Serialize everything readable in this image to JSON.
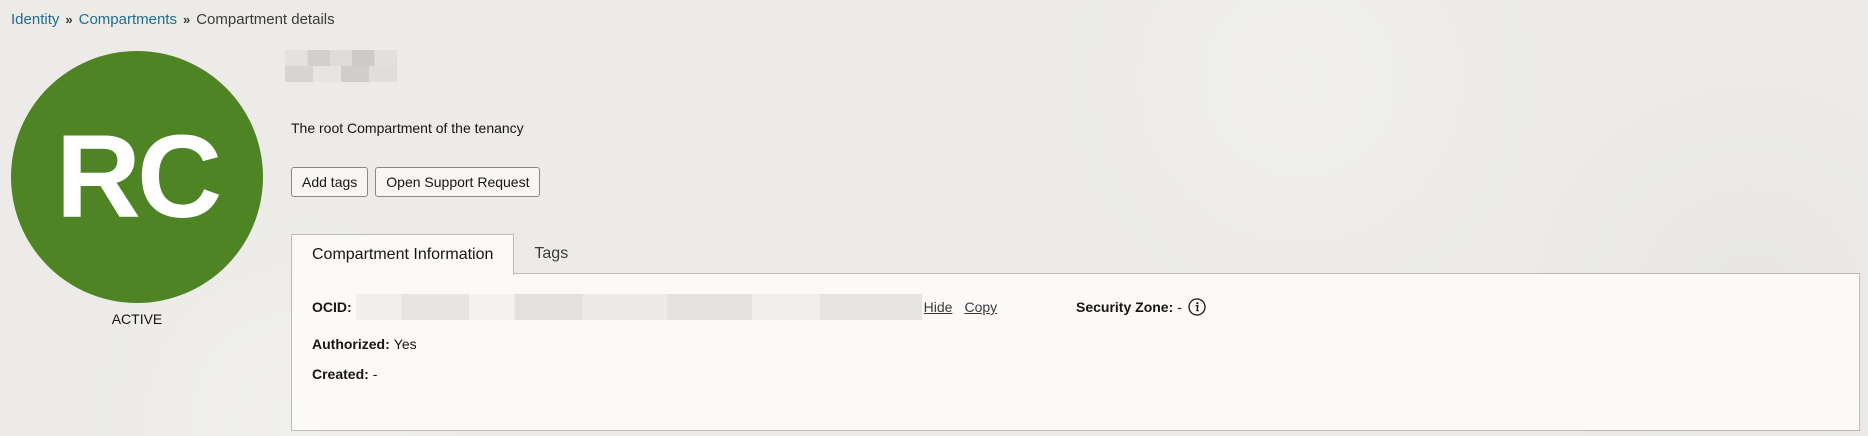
{
  "breadcrumb": {
    "items": [
      "Identity",
      "Compartments"
    ],
    "current": "Compartment details",
    "separator": "»"
  },
  "avatar": {
    "initials": "RC",
    "color": "#4e8424",
    "status": "ACTIVE"
  },
  "header": {
    "description": "The root Compartment of the tenancy"
  },
  "actions": {
    "add_tags": "Add tags",
    "open_support": "Open Support Request"
  },
  "tabs": [
    {
      "label": "Compartment Information",
      "active": true
    },
    {
      "label": "Tags",
      "active": false
    }
  ],
  "info": {
    "ocid_label": "OCID:",
    "ocid_hide": "Hide",
    "ocid_copy": "Copy",
    "authorized_label": "Authorized:",
    "authorized_value": "Yes",
    "created_label": "Created:",
    "created_value": "-",
    "security_zone_label": "Security Zone:",
    "security_zone_value": "-",
    "security_zone_icon": "info-icon"
  }
}
